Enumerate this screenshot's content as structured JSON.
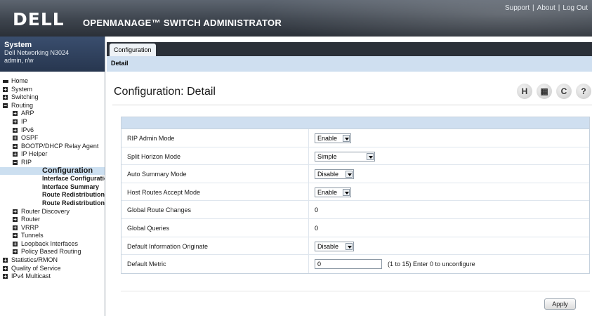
{
  "header": {
    "logo": "DELL",
    "product_title": "OPENMANAGE™ SWITCH ADMINISTRATOR",
    "links": [
      "Support",
      "About",
      "Log Out"
    ]
  },
  "system": {
    "title": "System",
    "device": "Dell Networking N3024",
    "user": "admin, r/w"
  },
  "nav": [
    {
      "label": "Home",
      "icon": "home-icon"
    },
    {
      "label": "System",
      "icon": "expand-icon"
    },
    {
      "label": "Switching",
      "icon": "expand-icon"
    },
    {
      "label": "Routing",
      "icon": "collapse-icon"
    },
    {
      "label": "ARP",
      "icon": "expand-icon"
    },
    {
      "label": "IP",
      "icon": "expand-icon"
    },
    {
      "label": "IPv6",
      "icon": "expand-icon"
    },
    {
      "label": "OSPF",
      "icon": "expand-icon"
    },
    {
      "label": "BOOTP/DHCP Relay Agent",
      "icon": "expand-icon"
    },
    {
      "label": "IP Helper",
      "icon": "expand-icon"
    },
    {
      "label": "RIP",
      "icon": "collapse-icon"
    },
    {
      "label": "Configuration",
      "icon": ""
    },
    {
      "label": "Interface Configuration",
      "icon": ""
    },
    {
      "label": "Interface Summary",
      "icon": ""
    },
    {
      "label": "Route Redistribution",
      "icon": ""
    },
    {
      "label": "Route Redistribution",
      "icon": ""
    },
    {
      "label": "Router Discovery",
      "icon": "expand-icon"
    },
    {
      "label": "Router",
      "icon": "expand-icon"
    },
    {
      "label": "VRRP",
      "icon": "expand-icon"
    },
    {
      "label": "Tunnels",
      "icon": "expand-icon"
    },
    {
      "label": "Loopback Interfaces",
      "icon": "expand-icon"
    },
    {
      "label": "Policy Based Routing",
      "icon": "expand-icon"
    },
    {
      "label": "Statistics/RMON",
      "icon": "expand-icon"
    },
    {
      "label": "Quality of Service",
      "icon": "expand-icon"
    },
    {
      "label": "IPv4 Multicast",
      "icon": "expand-icon"
    }
  ],
  "tabs": {
    "main": "Configuration",
    "sub": "Detail"
  },
  "page": {
    "title": "Configuration: Detail",
    "tool_icons": [
      "help-icon",
      "print-icon",
      "refresh-icon",
      "question-icon"
    ]
  },
  "form": {
    "rows": [
      {
        "label": "RIP Admin Mode",
        "type": "select",
        "value": "Enable"
      },
      {
        "label": "Split Horizon Mode",
        "type": "select",
        "value": "Simple"
      },
      {
        "label": "Auto Summary Mode",
        "type": "select",
        "value": "Disable"
      },
      {
        "label": "Host Routes Accept Mode",
        "type": "select",
        "value": "Enable"
      },
      {
        "label": "Global Route Changes",
        "type": "text",
        "value": "0"
      },
      {
        "label": "Global Queries",
        "type": "text",
        "value": "0"
      },
      {
        "label": "Default Information Originate",
        "type": "select",
        "value": "Disable"
      },
      {
        "label": "Default Metric",
        "type": "input",
        "value": "0",
        "hint": "(1 to 15) Enter 0 to unconfigure"
      }
    ],
    "apply_label": "Apply"
  },
  "colors": {
    "header_dark": "#2b3038",
    "accent_light": "#cfdff0",
    "selected_nav": "#ccdff0",
    "system_box": "#2f405c"
  }
}
